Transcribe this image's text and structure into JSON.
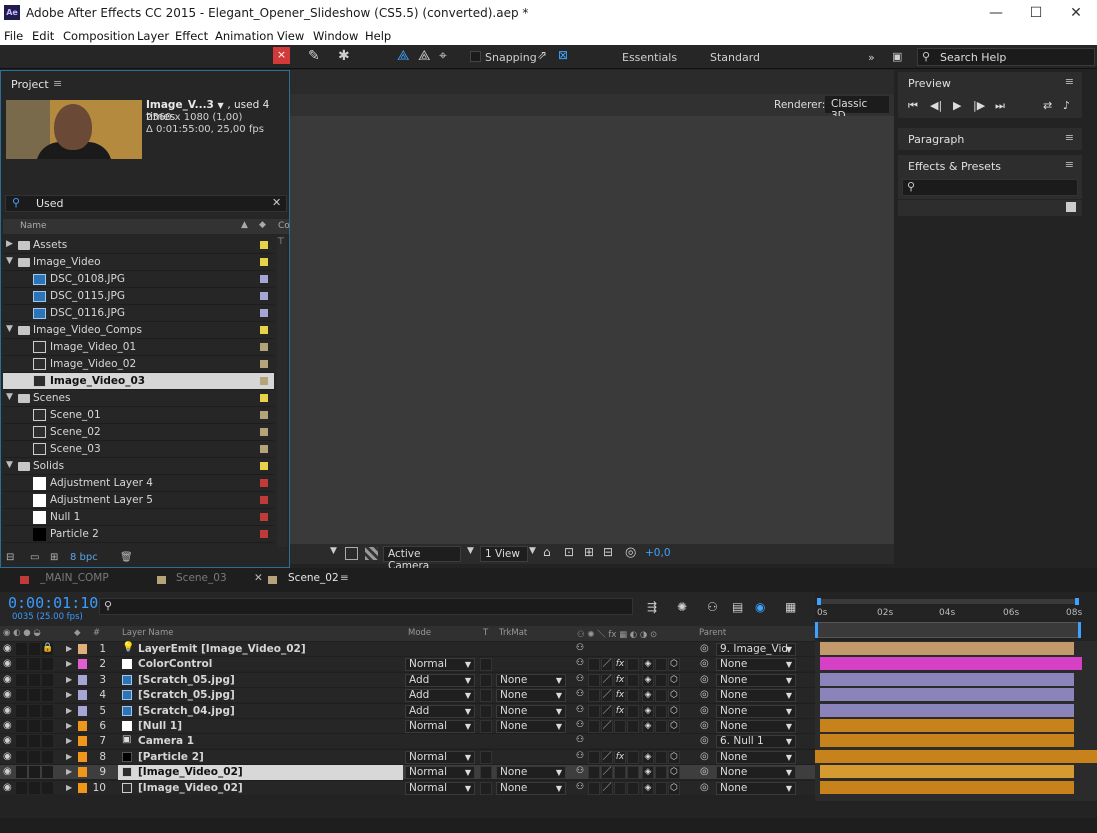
{
  "app": {
    "logo": "Ae",
    "title": "Adobe After Effects CC 2015 - Elegant_Opener_Slideshow (CS5.5) (converted).aep *",
    "window_buttons": [
      "—",
      "☐",
      "✕"
    ]
  },
  "menu": [
    "File",
    "Edit",
    "Composition",
    "Layer",
    "Effect",
    "Animation",
    "View",
    "Window",
    "Help"
  ],
  "toolbar": {
    "snapping_label": "Snapping",
    "workspaces": [
      "Essentials",
      "Standard"
    ],
    "overflow": "»",
    "search_help_placeholder": "Search Help"
  },
  "viewer": {
    "renderer_label": "Renderer:",
    "renderer_value": "Classic 3D",
    "camera": "Active Camera",
    "view_layout": "1 View",
    "exposure": "+0,0"
  },
  "right_panels": {
    "preview_title": "Preview",
    "preview_controls": [
      "⏮",
      "◀|",
      "▶",
      "|▶",
      "⏭"
    ],
    "paragraph_title": "Paragraph",
    "effects_title": "Effects & Presets",
    "menu_icon": "≡"
  },
  "project": {
    "title": "Project",
    "menu_icon": "≡",
    "close_label": "×",
    "selected_name": "Image_V...3",
    "selected_usage": ", used 4 times",
    "selected_size": "2560 x 1080 (1,00)",
    "selected_duration": "Δ 0:01:55:00, 25,00 fps",
    "search_value": "Used",
    "col_name": "Name",
    "col_comment": "Co",
    "bpc": "8 bpc",
    "rows": [
      {
        "name": "Assets",
        "type": "folder",
        "indent": 0,
        "expanded": false,
        "color": "#e8d24a"
      },
      {
        "name": "Image_Video",
        "type": "folder",
        "indent": 0,
        "expanded": true,
        "color": "#e8d24a"
      },
      {
        "name": "DSC_0108.JPG",
        "type": "image",
        "indent": 1,
        "color": "#a5a5d6"
      },
      {
        "name": "DSC_0115.JPG",
        "type": "image",
        "indent": 1,
        "color": "#a5a5d6"
      },
      {
        "name": "DSC_0116.JPG",
        "type": "image",
        "indent": 1,
        "color": "#a5a5d6"
      },
      {
        "name": "Image_Video_Comps",
        "type": "folder",
        "indent": 0,
        "expanded": true,
        "color": "#e8d24a"
      },
      {
        "name": "Image_Video_01",
        "type": "comp",
        "indent": 1,
        "color": "#b5a37a"
      },
      {
        "name": "Image_Video_02",
        "type": "comp",
        "indent": 1,
        "color": "#b5a37a"
      },
      {
        "name": "Image_Video_03",
        "type": "comp",
        "indent": 1,
        "color": "#b5a37a",
        "selected": true
      },
      {
        "name": "Scenes",
        "type": "folder",
        "indent": 0,
        "expanded": true,
        "color": "#e8d24a"
      },
      {
        "name": "Scene_01",
        "type": "comp",
        "indent": 1,
        "color": "#b5a37a"
      },
      {
        "name": "Scene_02",
        "type": "comp",
        "indent": 1,
        "color": "#b5a37a"
      },
      {
        "name": "Scene_03",
        "type": "comp",
        "indent": 1,
        "color": "#b5a37a"
      },
      {
        "name": "Solids",
        "type": "folder",
        "indent": 0,
        "expanded": true,
        "color": "#e8d24a"
      },
      {
        "name": "Adjustment Layer 4",
        "type": "solid",
        "indent": 1,
        "color": "#c03a3a",
        "solid_color": "#ffffff"
      },
      {
        "name": "Adjustment Layer 5",
        "type": "solid",
        "indent": 1,
        "color": "#c03a3a",
        "solid_color": "#ffffff"
      },
      {
        "name": "Null 1",
        "type": "solid",
        "indent": 1,
        "color": "#c03a3a",
        "solid_color": "#ffffff"
      },
      {
        "name": "Particle 2",
        "type": "solid",
        "indent": 1,
        "color": "#c03a3a",
        "solid_color": "#000000"
      }
    ]
  },
  "timeline": {
    "tabs": [
      "_MAIN_COMP",
      "Scene_03",
      "Scene_02"
    ],
    "active_tab": "Scene_02",
    "tab_menu": "≡",
    "timecode": "0:00:01:10",
    "frame_fps": "0035 (25.00 fps)",
    "ruler_labels": [
      "0s",
      "02s",
      "04s",
      "06s",
      "08s"
    ],
    "columns": {
      "layer_name": "Layer Name",
      "mode": "Mode",
      "t": "T",
      "trkmat": "TrkMat",
      "parent": "Parent",
      "hash": "#"
    },
    "layers": [
      {
        "num": "1",
        "name": "LayerEmit [Image_Video_02]",
        "label": "#e0b07a",
        "icon": "light",
        "mode": "",
        "trkmat": "",
        "parent": "9. Image_Vid",
        "bar": "#c39a6b",
        "fx": false,
        "lock": true
      },
      {
        "num": "2",
        "name": "ColorControl",
        "label": "#e05ed0",
        "icon": "solid-white",
        "mode": "Normal",
        "trkmat": "",
        "parent": "None",
        "bar": "#d640c4",
        "fx": true
      },
      {
        "num": "3",
        "name": "[Scratch_05.jpg]",
        "label": "#a5a5d6",
        "icon": "image",
        "mode": "Add",
        "trkmat": "None",
        "parent": "None",
        "bar": "#8a84bb",
        "fx": true
      },
      {
        "num": "4",
        "name": "[Scratch_05.jpg]",
        "label": "#a5a5d6",
        "icon": "image",
        "mode": "Add",
        "trkmat": "None",
        "parent": "None",
        "bar": "#8a84bb",
        "fx": true
      },
      {
        "num": "5",
        "name": "[Scratch_04.jpg]",
        "label": "#a5a5d6",
        "icon": "image",
        "mode": "Add",
        "trkmat": "None",
        "parent": "None",
        "bar": "#8a84bb",
        "fx": true
      },
      {
        "num": "6",
        "name": "[Null 1]",
        "label": "#f0961a",
        "icon": "solid-white",
        "mode": "Normal",
        "trkmat": "None",
        "parent": "None",
        "bar": "#c8821c",
        "fx": false
      },
      {
        "num": "7",
        "name": "Camera 1",
        "label": "#f0961a",
        "icon": "camera",
        "mode": "",
        "trkmat": "",
        "parent": "6. Null 1",
        "bar": "#c8821c",
        "fx": false
      },
      {
        "num": "8",
        "name": "[Particle 2]",
        "label": "#f0961a",
        "icon": "solid-black",
        "mode": "Normal",
        "trkmat": "",
        "parent": "None",
        "bar": "#c8821c",
        "fx": true
      },
      {
        "num": "9",
        "name": "[Image_Video_02]",
        "label": "#f0961a",
        "icon": "comp",
        "mode": "Normal",
        "trkmat": "None",
        "parent": "None",
        "bar": "#d59a30",
        "fx": false,
        "selected": true
      },
      {
        "num": "10",
        "name": "[Image_Video_02]",
        "label": "#f0961a",
        "icon": "comp",
        "mode": "Normal",
        "trkmat": "None",
        "parent": "None",
        "bar": "#c8821c",
        "fx": false
      }
    ]
  }
}
